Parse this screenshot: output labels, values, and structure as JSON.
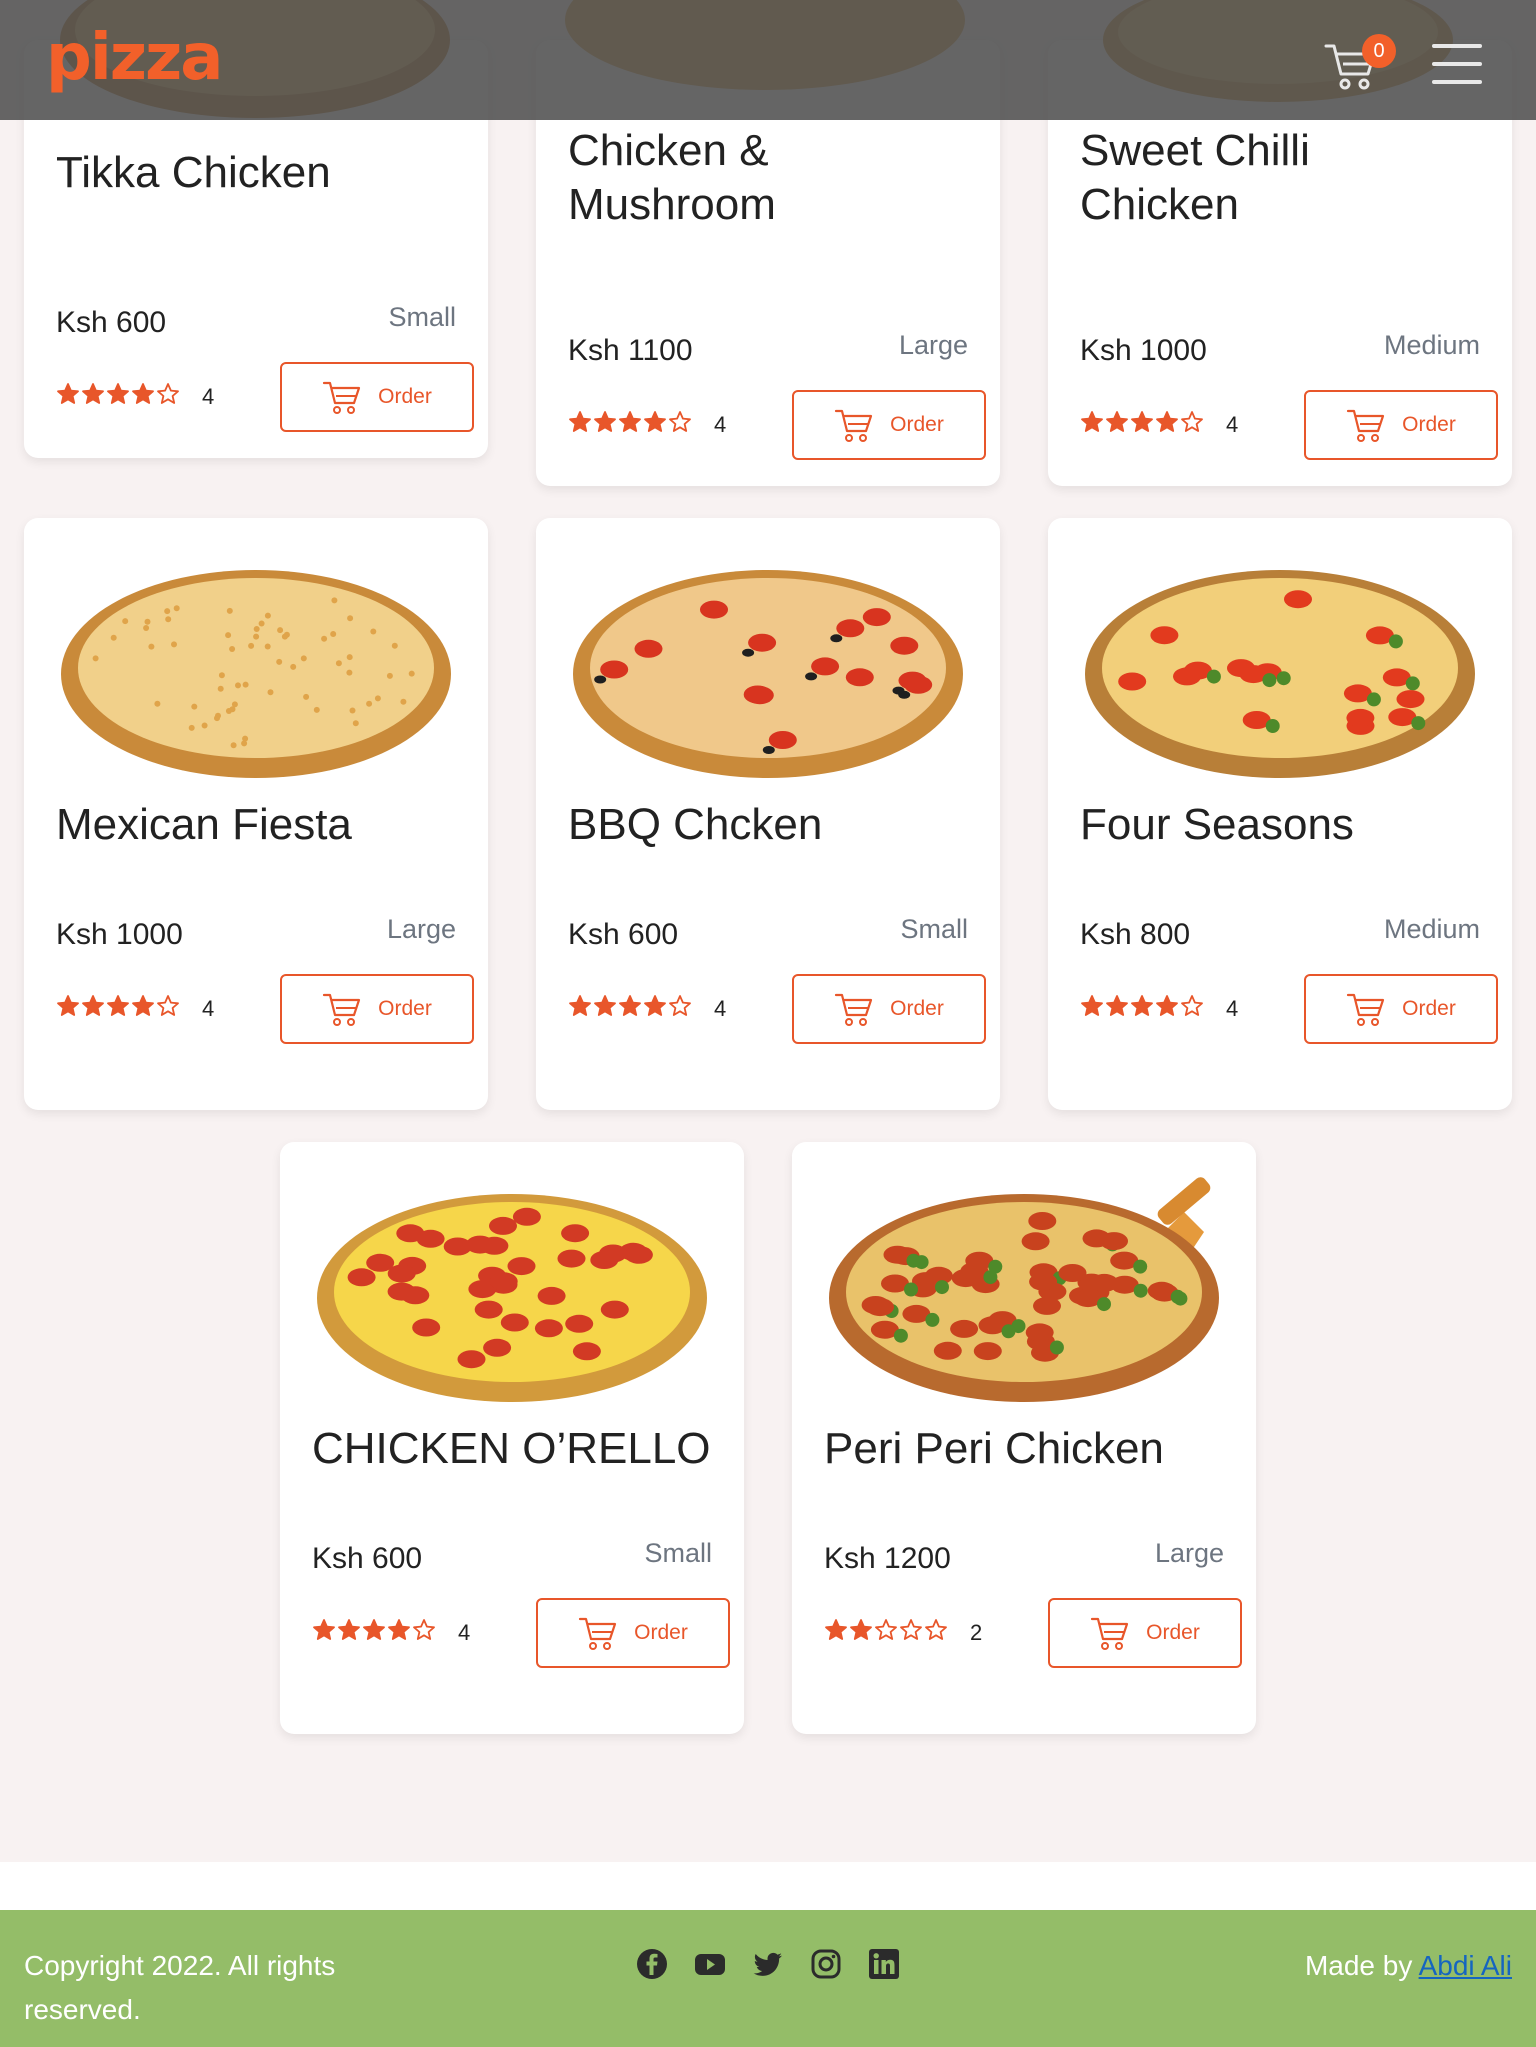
{
  "header": {
    "logo": "pizza",
    "cart_count": "0"
  },
  "menu": {
    "order_label": "Order",
    "items": [
      {
        "name": "Tikka Chicken",
        "price": "Ksh 600",
        "size": "Small",
        "rating": "4",
        "stars": 4
      },
      {
        "name": "Chicken & Mushroom",
        "price": "Ksh 1100",
        "size": "Large",
        "rating": "4",
        "stars": 4
      },
      {
        "name": "Sweet Chilli Chicken",
        "price": "Ksh 1000",
        "size": "Medium",
        "rating": "4",
        "stars": 4
      },
      {
        "name": "Mexican Fiesta",
        "price": "Ksh 1000",
        "size": "Large",
        "rating": "4",
        "stars": 4
      },
      {
        "name": "BBQ Chcken",
        "price": "Ksh 600",
        "size": "Small",
        "rating": "4",
        "stars": 4
      },
      {
        "name": "Four Seasons",
        "price": "Ksh 800",
        "size": "Medium",
        "rating": "4",
        "stars": 4
      },
      {
        "name": "CHICKEN O’RELLO",
        "price": "Ksh 600",
        "size": "Small",
        "rating": "4",
        "stars": 4
      },
      {
        "name": "Peri Peri Chicken",
        "price": "Ksh 1200",
        "size": "Large",
        "rating": "2",
        "stars": 2
      }
    ]
  },
  "footer": {
    "copyright": "Copyright 2022. All rights reserved.",
    "made_by_prefix": "Made by",
    "author": "Abdi Ali",
    "socials": [
      "facebook-icon",
      "youtube-icon",
      "twitter-icon",
      "instagram-icon",
      "linkedin-icon"
    ]
  },
  "colors": {
    "accent": "#e8562a",
    "footer_bg": "#94bd68",
    "page_bg": "#f8f2f2"
  }
}
